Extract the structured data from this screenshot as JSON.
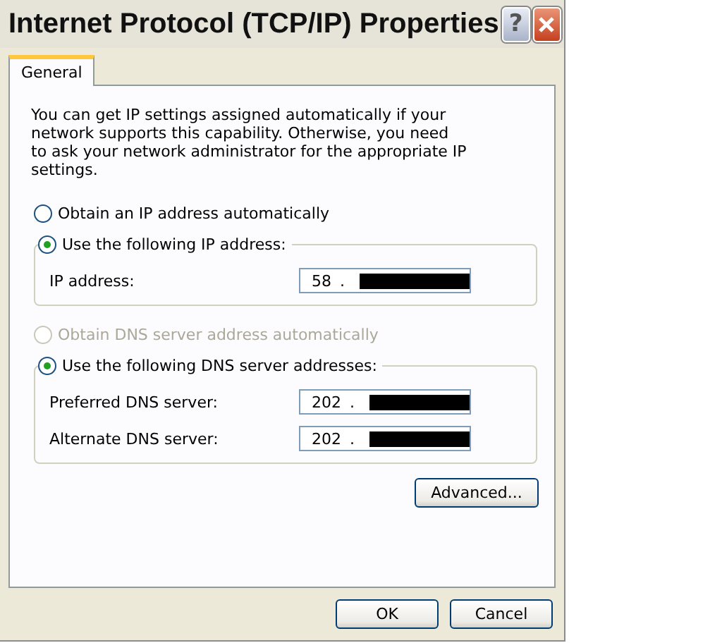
{
  "window": {
    "title": "Internet Protocol (TCP/IP) Properties",
    "buttons": [
      {
        "kind": "help",
        "label": "?"
      },
      {
        "kind": "close"
      }
    ]
  },
  "tabs": [
    {
      "label": "General",
      "selected": true
    }
  ],
  "intro": "You can get IP settings assigned automatically if your network supports this capability. Otherwise, you need to ask your network administrator for the appropriate IP settings.",
  "ip_options": [
    {
      "label": "Obtain an IP address automatically",
      "selected": false,
      "disabled": false
    },
    {
      "label": "Use the following IP address:",
      "selected": true,
      "disabled": false,
      "fields": [
        {
          "label": "IP address:",
          "first_octet": "58",
          "separator": ".",
          "redacted": true
        }
      ]
    }
  ],
  "dns_options": [
    {
      "label": "Obtain DNS server address automatically",
      "selected": false,
      "disabled": true
    },
    {
      "label": "Use the following DNS server addresses:",
      "selected": true,
      "disabled": false,
      "fields": [
        {
          "label": "Preferred DNS server:",
          "first_octet": "202",
          "separator": ".",
          "redacted": true
        },
        {
          "label": "Alternate DNS server:",
          "first_octet": "202",
          "separator": ".",
          "redacted": true
        }
      ]
    }
  ],
  "advanced_button": "Advanced...",
  "footer_buttons": [
    "OK",
    "Cancel"
  ]
}
